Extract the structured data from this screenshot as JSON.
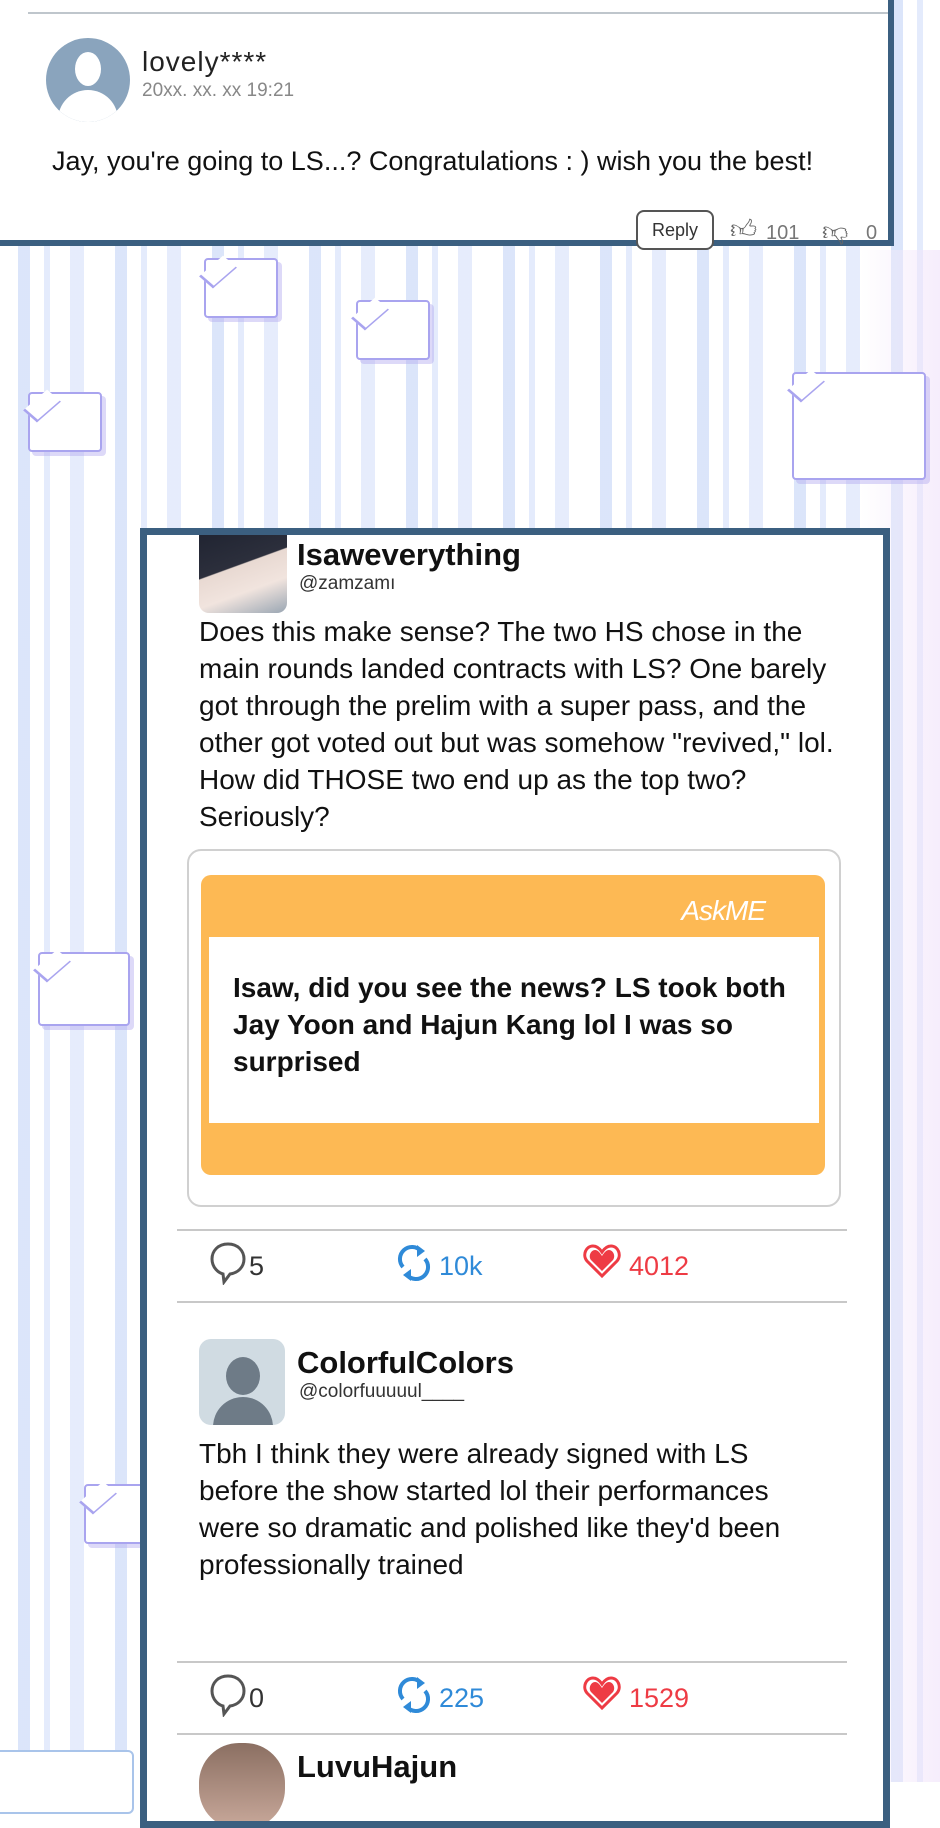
{
  "top_comment": {
    "username": "lovely****",
    "date": "20xx. xx. xx  19:21",
    "text": "Jay, you're going to LS...? Congratulations : ) wish you the best!",
    "reply_label": "Reply",
    "likes": "101",
    "dislikes": "0"
  },
  "post": {
    "name": "Isaweverything",
    "handle": "@zamzamı",
    "text": "Does this make sense? The two HS chose in the main rounds landed contracts with LS? One barely got through the prelim with a super pass, and the other got voted out but was somehow \"revived,\" lol. How did THOSE two end up as the top two? Seriously?",
    "askme": {
      "logo": "AskME",
      "question": "Isaw, did you see the news? LS took both Jay Yoon and Hajun Kang lol I was so surprised"
    },
    "stats": {
      "replies": "5",
      "retweets": "10k",
      "likes": "4012"
    }
  },
  "reply1": {
    "name": "ColorfulColors",
    "handle": "@colorfuuuuul____",
    "text": "Tbh I think they were already signed with LS before the show started lol their performances were so dramatic and polished like they'd been professionally trained",
    "stats": {
      "replies": "0",
      "retweets": "225",
      "likes": "1529"
    }
  },
  "reply2": {
    "name": "LuvuHajun"
  },
  "colors": {
    "frame": "#3b5f80",
    "askme_orange": "#fdb954",
    "retweet_blue": "#2f8ad8",
    "like_red": "#ee3b44"
  }
}
